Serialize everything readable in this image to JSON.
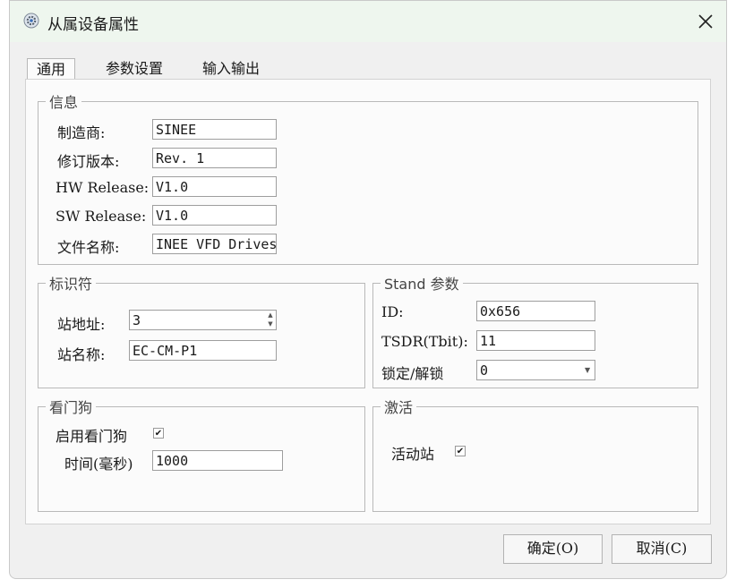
{
  "window": {
    "title": "从属设备属性"
  },
  "tabs": [
    {
      "label": "通用"
    },
    {
      "label": "参数设置"
    },
    {
      "label": "输入输出"
    }
  ],
  "info": {
    "legend": "信息",
    "fields": [
      {
        "label": "制造商:",
        "value": "SINEE"
      },
      {
        "label": "修订版本:",
        "value": "Rev. 1"
      },
      {
        "label": "HW Release:",
        "value": "V1.0"
      },
      {
        "label": "SW Release:",
        "value": "V1.0"
      },
      {
        "label": "文件名称:",
        "value": "INEE VFD Drives"
      }
    ]
  },
  "identifier": {
    "legend": "标识符",
    "station_address_label": "站地址:",
    "station_address_value": "3",
    "station_name_label": "站名称:",
    "station_name_value": "EC-CM-P1"
  },
  "stand": {
    "legend": "Stand 参数",
    "id_label": "ID:",
    "id_value": "0x656",
    "tsdr_label": "TSDR(Tbit):",
    "tsdr_value": "11",
    "lock_label": "锁定/解锁",
    "lock_value": "0"
  },
  "watchdog": {
    "legend": "看门狗",
    "enable_label": "启用看门狗",
    "enable_checked": "✔",
    "time_label": "时间(毫秒)",
    "time_value": "1000"
  },
  "activation": {
    "legend": "激活",
    "active_label": "活动站",
    "active_checked": "✔"
  },
  "buttons": {
    "ok": "确定(O)",
    "cancel": "取消(C)"
  },
  "colors": {
    "titlebar": "#eef6ee",
    "panel": "#fbfbfb"
  }
}
